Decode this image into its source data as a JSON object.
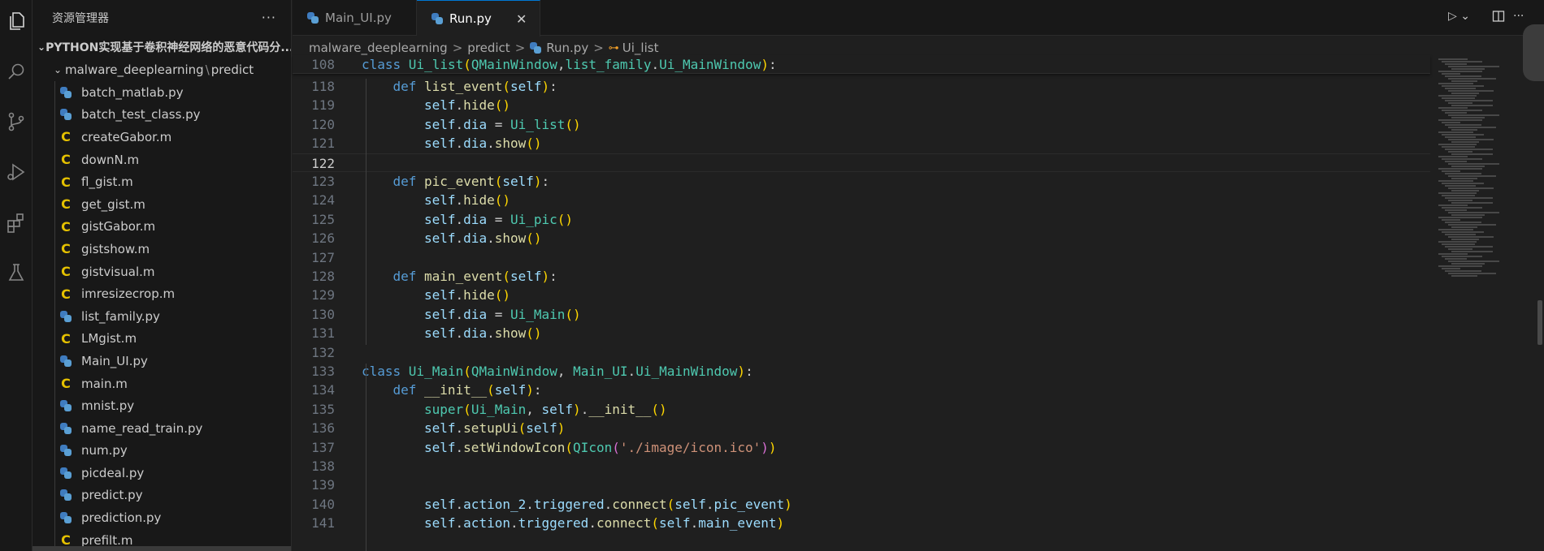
{
  "colors": {
    "accent": "#0078d4",
    "m_file": "#e5c100",
    "python": "#3f7cbf"
  },
  "sidebar": {
    "title": "资源管理器",
    "more": "···",
    "project": "PYTHON实现基于卷积神经网络的恶意代码分...",
    "folder_parent": "malware_deeplearning",
    "folder_sep": "\\",
    "folder_child": "predict",
    "files": [
      {
        "name": "batch_matlab.py",
        "type": "py"
      },
      {
        "name": "batch_test_class.py",
        "type": "py"
      },
      {
        "name": "createGabor.m",
        "type": "m"
      },
      {
        "name": "downN.m",
        "type": "m"
      },
      {
        "name": "fl_gist.m",
        "type": "m"
      },
      {
        "name": "get_gist.m",
        "type": "m"
      },
      {
        "name": "gistGabor.m",
        "type": "m"
      },
      {
        "name": "gistshow.m",
        "type": "m"
      },
      {
        "name": "gistvisual.m",
        "type": "m"
      },
      {
        "name": "imresizecrop.m",
        "type": "m"
      },
      {
        "name": "list_family.py",
        "type": "py"
      },
      {
        "name": "LMgist.m",
        "type": "m"
      },
      {
        "name": "Main_UI.py",
        "type": "py"
      },
      {
        "name": "main.m",
        "type": "m"
      },
      {
        "name": "mnist.py",
        "type": "py"
      },
      {
        "name": "name_read_train.py",
        "type": "py"
      },
      {
        "name": "num.py",
        "type": "py"
      },
      {
        "name": "picdeal.py",
        "type": "py"
      },
      {
        "name": "predict.py",
        "type": "py"
      },
      {
        "name": "prediction.py",
        "type": "py"
      },
      {
        "name": "prefilt.m",
        "type": "m"
      }
    ],
    "m_glyph": "C"
  },
  "tabs": [
    {
      "label": "Main_UI.py",
      "active": false
    },
    {
      "label": "Run.py",
      "active": true,
      "close": "✕"
    }
  ],
  "breadcrumb": [
    "malware_deeplearning",
    "predict",
    "Run.py",
    "Ui_list"
  ],
  "breadcrumb_sep": ">",
  "editor": {
    "current_line": 122,
    "lines": [
      {
        "num": 108,
        "sticky": true,
        "indent": 0,
        "tokens": [
          [
            "kw",
            "class "
          ],
          [
            "cls",
            "Ui_list"
          ],
          [
            "bracket1",
            "("
          ],
          [
            "cls",
            "QMainWindow"
          ],
          [
            "",
            ","
          ],
          [
            "cls",
            "list_family"
          ],
          [
            "",
            "."
          ],
          [
            "cls",
            "Ui_MainWindow"
          ],
          [
            "bracket1",
            ")"
          ],
          [
            "",
            ":"
          ]
        ]
      },
      {
        "num": 118,
        "indent": 1,
        "tokens": [
          [
            "kw",
            "def "
          ],
          [
            "fn",
            "list_event"
          ],
          [
            "bracket1",
            "("
          ],
          [
            "self",
            "self"
          ],
          [
            "bracket1",
            ")"
          ],
          [
            "",
            ":"
          ]
        ]
      },
      {
        "num": 119,
        "indent": 2,
        "tokens": [
          [
            "self",
            "self"
          ],
          [
            "",
            "."
          ],
          [
            "fn",
            "hide"
          ],
          [
            "bracket1",
            "()"
          ]
        ]
      },
      {
        "num": 120,
        "indent": 2,
        "tokens": [
          [
            "self",
            "self"
          ],
          [
            "",
            "."
          ],
          [
            "self",
            "dia"
          ],
          [
            "",
            " = "
          ],
          [
            "cls",
            "Ui_list"
          ],
          [
            "bracket1",
            "()"
          ]
        ]
      },
      {
        "num": 121,
        "indent": 2,
        "tokens": [
          [
            "self",
            "self"
          ],
          [
            "",
            "."
          ],
          [
            "self",
            "dia"
          ],
          [
            "",
            "."
          ],
          [
            "fn",
            "show"
          ],
          [
            "bracket1",
            "()"
          ]
        ]
      },
      {
        "num": 122,
        "indent": 0,
        "tokens": []
      },
      {
        "num": 123,
        "indent": 1,
        "tokens": [
          [
            "kw",
            "def "
          ],
          [
            "fn",
            "pic_event"
          ],
          [
            "bracket1",
            "("
          ],
          [
            "self",
            "self"
          ],
          [
            "bracket1",
            ")"
          ],
          [
            "",
            ":"
          ]
        ]
      },
      {
        "num": 124,
        "indent": 2,
        "tokens": [
          [
            "self",
            "self"
          ],
          [
            "",
            "."
          ],
          [
            "fn",
            "hide"
          ],
          [
            "bracket1",
            "()"
          ]
        ]
      },
      {
        "num": 125,
        "indent": 2,
        "tokens": [
          [
            "self",
            "self"
          ],
          [
            "",
            "."
          ],
          [
            "self",
            "dia"
          ],
          [
            "",
            " = "
          ],
          [
            "cls",
            "Ui_pic"
          ],
          [
            "bracket1",
            "()"
          ]
        ]
      },
      {
        "num": 126,
        "indent": 2,
        "tokens": [
          [
            "self",
            "self"
          ],
          [
            "",
            "."
          ],
          [
            "self",
            "dia"
          ],
          [
            "",
            "."
          ],
          [
            "fn",
            "show"
          ],
          [
            "bracket1",
            "()"
          ]
        ]
      },
      {
        "num": 127,
        "indent": 0,
        "tokens": []
      },
      {
        "num": 128,
        "indent": 1,
        "tokens": [
          [
            "kw",
            "def "
          ],
          [
            "fn",
            "main_event"
          ],
          [
            "bracket1",
            "("
          ],
          [
            "self",
            "self"
          ],
          [
            "bracket1",
            ")"
          ],
          [
            "",
            ":"
          ]
        ]
      },
      {
        "num": 129,
        "indent": 2,
        "tokens": [
          [
            "self",
            "self"
          ],
          [
            "",
            "."
          ],
          [
            "fn",
            "hide"
          ],
          [
            "bracket1",
            "()"
          ]
        ]
      },
      {
        "num": 130,
        "indent": 2,
        "tokens": [
          [
            "self",
            "self"
          ],
          [
            "",
            "."
          ],
          [
            "self",
            "dia"
          ],
          [
            "",
            " = "
          ],
          [
            "cls",
            "Ui_Main"
          ],
          [
            "bracket1",
            "()"
          ]
        ]
      },
      {
        "num": 131,
        "indent": 2,
        "tokens": [
          [
            "self",
            "self"
          ],
          [
            "",
            "."
          ],
          [
            "self",
            "dia"
          ],
          [
            "",
            "."
          ],
          [
            "fn",
            "show"
          ],
          [
            "bracket1",
            "()"
          ]
        ]
      },
      {
        "num": 132,
        "indent": 0,
        "tokens": []
      },
      {
        "num": 133,
        "indent": 0,
        "tokens": [
          [
            "kw",
            "class "
          ],
          [
            "cls",
            "Ui_Main"
          ],
          [
            "bracket1",
            "("
          ],
          [
            "cls",
            "QMainWindow"
          ],
          [
            "",
            ", "
          ],
          [
            "cls",
            "Main_UI"
          ],
          [
            "",
            "."
          ],
          [
            "cls",
            "Ui_MainWindow"
          ],
          [
            "bracket1",
            ")"
          ],
          [
            "",
            ":"
          ]
        ]
      },
      {
        "num": 134,
        "indent": 1,
        "tokens": [
          [
            "kw",
            "def "
          ],
          [
            "fn",
            "__init__"
          ],
          [
            "bracket1",
            "("
          ],
          [
            "self",
            "self"
          ],
          [
            "bracket1",
            ")"
          ],
          [
            "",
            ":"
          ]
        ]
      },
      {
        "num": 135,
        "indent": 2,
        "tokens": [
          [
            "cls",
            "super"
          ],
          [
            "bracket1",
            "("
          ],
          [
            "cls",
            "Ui_Main"
          ],
          [
            "",
            ", "
          ],
          [
            "self",
            "self"
          ],
          [
            "bracket1",
            ")"
          ],
          [
            "",
            "."
          ],
          [
            "fn",
            "__init__"
          ],
          [
            "bracket1",
            "()"
          ]
        ]
      },
      {
        "num": 136,
        "indent": 2,
        "tokens": [
          [
            "self",
            "self"
          ],
          [
            "",
            "."
          ],
          [
            "fn",
            "setupUi"
          ],
          [
            "bracket1",
            "("
          ],
          [
            "self",
            "self"
          ],
          [
            "bracket1",
            ")"
          ]
        ]
      },
      {
        "num": 137,
        "indent": 2,
        "tokens": [
          [
            "self",
            "self"
          ],
          [
            "",
            "."
          ],
          [
            "fn",
            "setWindowIcon"
          ],
          [
            "bracket1",
            "("
          ],
          [
            "cls",
            "QIcon"
          ],
          [
            "bracket2",
            "("
          ],
          [
            "str",
            "'./image/icon.ico'"
          ],
          [
            "bracket2",
            ")"
          ],
          [
            "bracket1",
            ")"
          ]
        ]
      },
      {
        "num": 138,
        "indent": 0,
        "tokens": []
      },
      {
        "num": 139,
        "indent": 0,
        "tokens": []
      },
      {
        "num": 140,
        "indent": 2,
        "tokens": [
          [
            "self",
            "self"
          ],
          [
            "",
            "."
          ],
          [
            "self",
            "action_2"
          ],
          [
            "",
            "."
          ],
          [
            "self",
            "triggered"
          ],
          [
            "",
            "."
          ],
          [
            "fn",
            "connect"
          ],
          [
            "bracket1",
            "("
          ],
          [
            "self",
            "self"
          ],
          [
            "",
            "."
          ],
          [
            "self",
            "pic_event"
          ],
          [
            "bracket1",
            ")"
          ]
        ]
      },
      {
        "num": 141,
        "indent": 2,
        "tokens": [
          [
            "self",
            "self"
          ],
          [
            "",
            "."
          ],
          [
            "self",
            "action"
          ],
          [
            "",
            "."
          ],
          [
            "self",
            "triggered"
          ],
          [
            "",
            "."
          ],
          [
            "fn",
            "connect"
          ],
          [
            "bracket1",
            "("
          ],
          [
            "self",
            "self"
          ],
          [
            "",
            "."
          ],
          [
            "self",
            "main_event"
          ],
          [
            "bracket1",
            ")"
          ]
        ]
      }
    ]
  }
}
